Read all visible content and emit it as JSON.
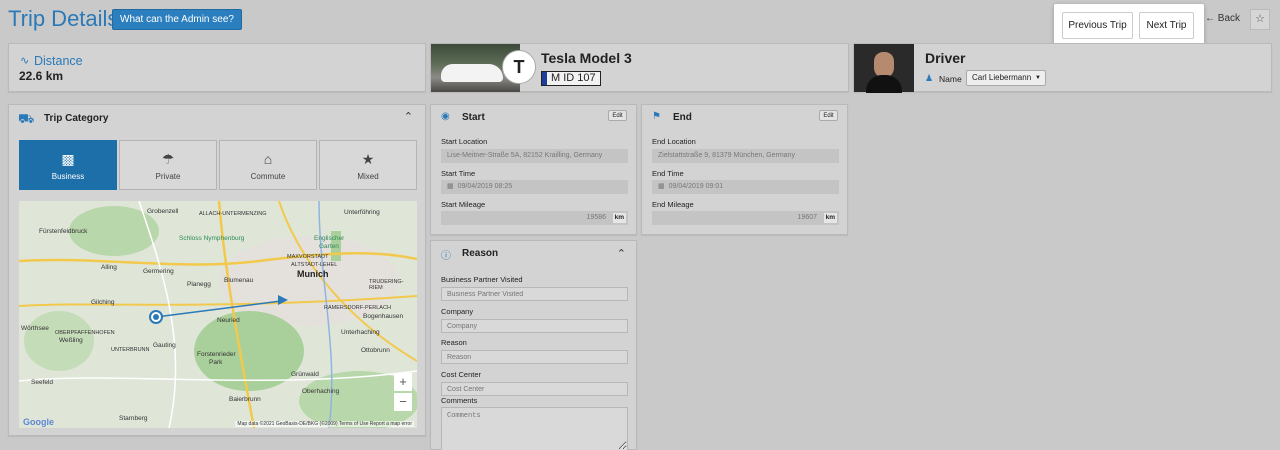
{
  "header": {
    "title": "Trip Details",
    "admin_button": "What can the Admin see?",
    "previous_trip": "Previous Trip",
    "next_trip": "Next Trip",
    "back": "Back"
  },
  "distance": {
    "label": "Distance",
    "value": "22.6 km"
  },
  "vehicle": {
    "name": "Tesla Model 3",
    "plate": "M ID 107",
    "badge": "T"
  },
  "driver": {
    "title": "Driver",
    "name_label": "Name",
    "name_value": "Carl Liebermann"
  },
  "trip_category": {
    "title": "Trip Category",
    "options": [
      {
        "label": "Business",
        "icon": "briefcase-icon",
        "active": true
      },
      {
        "label": "Private",
        "icon": "umbrella-icon",
        "active": false
      },
      {
        "label": "Commute",
        "icon": "house-icon",
        "active": false
      },
      {
        "label": "Mixed",
        "icon": "star-icon",
        "active": false
      }
    ]
  },
  "map": {
    "places": {
      "grobenzell": "Grobenzell",
      "allach": "ALLACH-UNTERMENZING",
      "unterfohring": "Unterföhring",
      "furstenfeldbruck": "Fürstenfeldbruck",
      "schloss": "Schloss Nymphenburg",
      "englischer": "Englischer",
      "garten": "Garten",
      "germering": "Germering",
      "alling": "Alling",
      "maxvorstadt": "MAXVORSTADT",
      "altstadt": "ALTSTADT-LEHEL",
      "munich": "Munich",
      "blumenau": "Blumenau",
      "trudering": "TRUDERING-RIEM",
      "gilching": "Gilching",
      "planegg": "Planegg",
      "ramersdorf": "RAMERSDORF-PERLACH",
      "neuried": "Neuried",
      "worthsee": "Wörthsee",
      "weßling": "Weßling",
      "gauting": "Gauting",
      "unterbrunn": "UNTERBRUNN",
      "forstenrieder": "Forstenrieder",
      "park": "Park",
      "unterhaching": "Unterhaching",
      "ottobrunn": "Ottobrunn",
      "grunwald": "Grünwald",
      "oberhaching": "Oberhaching",
      "starnberg": "Starnberg",
      "baierbrunn": "Baierbrunn",
      "seefeld": "Seefeld",
      "bogenhausen": "Bogenhausen",
      "oberpfaffenhofen": "OBERPFAFFENHOFEN"
    },
    "google": "Google",
    "attribution": "Map data ©2021 GeoBasis-DE/BKG (©2009)   Terms of Use   Report a map error"
  },
  "start": {
    "title": "Start",
    "edit": "Edit",
    "location_label": "Start Location",
    "location": "Lise-Meitner-Straße 5A, 82152 Krailling, Germany",
    "time_label": "Start Time",
    "time": "09/04/2019 08:25",
    "mileage_label": "Start Mileage",
    "mileage": "19586",
    "unit": "km"
  },
  "end": {
    "title": "End",
    "edit": "Edit",
    "location_label": "End Location",
    "location": "Zielstattstraße 9, 81379 München, Germany",
    "time_label": "End Time",
    "time": "09/04/2019 09:01",
    "mileage_label": "End Mileage",
    "mileage": "19607",
    "unit": "km"
  },
  "reason": {
    "title": "Reason",
    "partner_label": "Business Partner Visited",
    "partner_placeholder": "Business Partner Visited",
    "company_label": "Company",
    "company_placeholder": "Company",
    "reason_label": "Reason",
    "reason_placeholder": "Reason",
    "cost_label": "Cost Center",
    "cost_placeholder": "Cost Center",
    "comments_label": "Comments",
    "comments_placeholder": "Comments"
  },
  "colors": {
    "accent": "#2a79b8",
    "active_tile": "#1d6fa9",
    "background": "#c9c9c9"
  }
}
